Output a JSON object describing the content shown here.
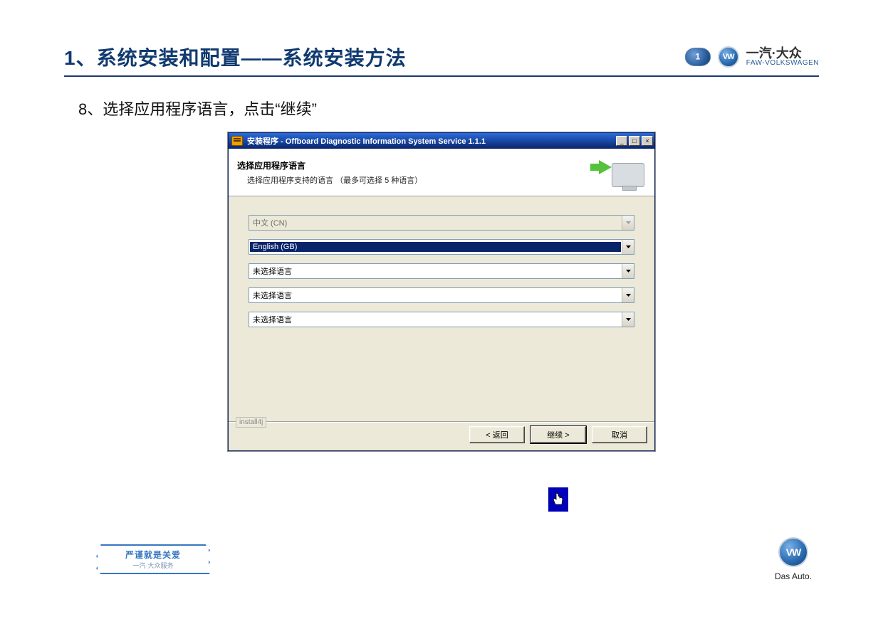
{
  "header": {
    "title": "1、系统安装和配置——系统安装方法",
    "brand_cn": "一汽·大众",
    "brand_en": "FAW-VOLKSWAGEN",
    "vw_glyph": "VW"
  },
  "step": {
    "text": "8、选择应用程序语言，点击“继续”"
  },
  "installer": {
    "title": "安装程序 - Offboard Diagnostic Information System Service 1.1.1",
    "banner_title": "选择应用程序语言",
    "banner_sub": "选择应用程序支持的语言 （最多可选择 5 种语言）",
    "combos": [
      {
        "value": "中文 (CN)",
        "state": "disabled"
      },
      {
        "value": "English (GB)",
        "state": "selected"
      },
      {
        "value": "未选择语言",
        "state": "normal"
      },
      {
        "value": "未选择语言",
        "state": "normal"
      },
      {
        "value": "未选择语言",
        "state": "normal"
      }
    ],
    "install4j": "install4j",
    "buttons": {
      "back": "< 返回",
      "next": "继续 >",
      "cancel": "取消"
    },
    "titlebar_buttons": {
      "min": "_",
      "max": "□",
      "close": "×"
    }
  },
  "footer": {
    "badge_main": "严谨就是关爱",
    "badge_sub": "一汽·大众服务",
    "das_auto": "Das Auto."
  }
}
